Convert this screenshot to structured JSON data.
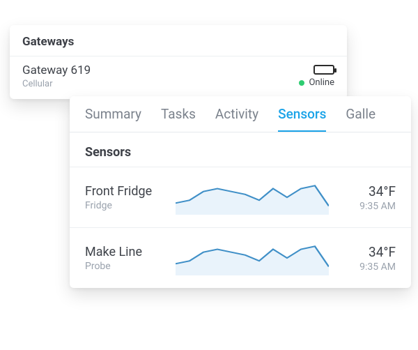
{
  "gateways": {
    "section_title": "Gateways",
    "rows": [
      {
        "name": "Gateway 619",
        "connection_type": "Cellular",
        "status_label": "Online",
        "status_color": "#2ecc71"
      }
    ]
  },
  "tabs": [
    {
      "label": "Summary",
      "active": false
    },
    {
      "label": "Tasks",
      "active": false
    },
    {
      "label": "Activity",
      "active": false
    },
    {
      "label": "Sensors",
      "active": true
    },
    {
      "label": "Galle",
      "active": false
    }
  ],
  "sensors": {
    "section_title": "Sensors",
    "rows": [
      {
        "name": "Front Fridge",
        "type": "Fridge",
        "value": "34°F",
        "timestamp": "9:35 AM"
      },
      {
        "name": "Make Line",
        "type": "Probe",
        "value": "34°F",
        "timestamp": "9:35 AM"
      }
    ]
  },
  "chart_data": [
    {
      "type": "line",
      "title": "Front Fridge",
      "x": [
        0,
        1,
        2,
        3,
        4,
        5,
        6,
        7,
        8,
        9,
        10,
        11
      ],
      "values": [
        34,
        35,
        38,
        39,
        38,
        37,
        35,
        39,
        36,
        39,
        40,
        33
      ],
      "ylim": [
        30,
        42
      ],
      "ylabel": "°F"
    },
    {
      "type": "line",
      "title": "Make Line",
      "x": [
        0,
        1,
        2,
        3,
        4,
        5,
        6,
        7,
        8,
        9,
        10,
        11
      ],
      "values": [
        34,
        35,
        38,
        39,
        38,
        37,
        35,
        39,
        36,
        39,
        40,
        33
      ],
      "ylim": [
        30,
        42
      ],
      "ylabel": "°F"
    }
  ],
  "colors": {
    "accent": "#1aa3e8",
    "chart_line": "#3f8fc7",
    "chart_fill": "#e9f3fb"
  }
}
